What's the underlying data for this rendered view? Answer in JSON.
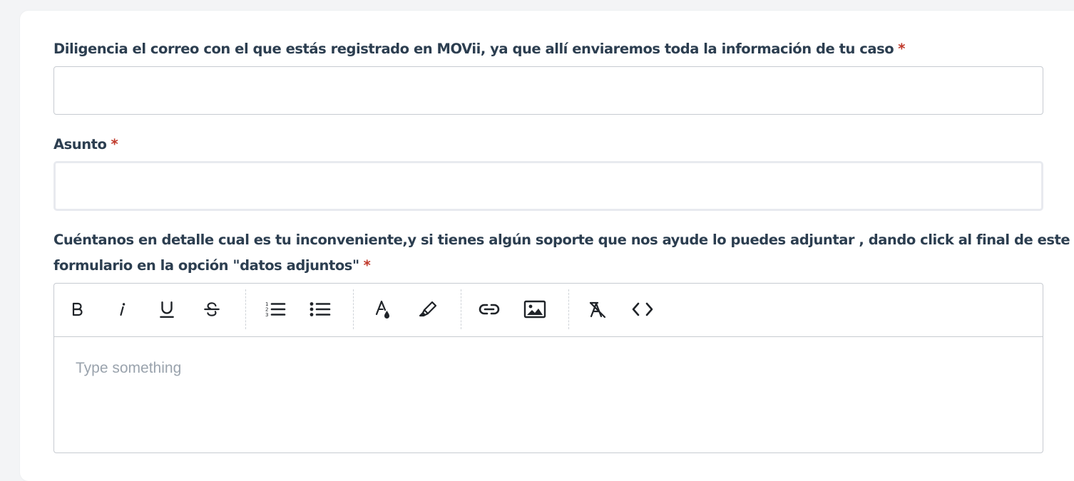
{
  "form": {
    "email_label": "Diligencia el correo con el que estás registrado en MOVii, ya que allí enviaremos toda la información de tu caso",
    "email_value": "",
    "subject_label": "Asunto",
    "subject_value": "",
    "description_label_line1": "Cuéntanos en detalle cual es tu inconveniente,y si tienes algún soporte que nos ayude lo puedes adjuntar , dando click al final de este",
    "description_label_line2": "formulario en la opción \"datos adjuntos\"",
    "required_marker": "*",
    "editor_placeholder": "Type something"
  },
  "toolbar": {
    "buttons": [
      "bold-icon",
      "italic-icon",
      "underline-icon",
      "strikethrough-icon",
      "ordered-list-icon",
      "bullet-list-icon",
      "text-color-icon",
      "highlight-icon",
      "link-icon",
      "image-icon",
      "clear-format-icon",
      "code-view-icon"
    ]
  },
  "colors": {
    "label": "#2c3e50",
    "required": "#c0392b",
    "border": "#c7cbd1",
    "placeholder": "#9aa3ad"
  }
}
